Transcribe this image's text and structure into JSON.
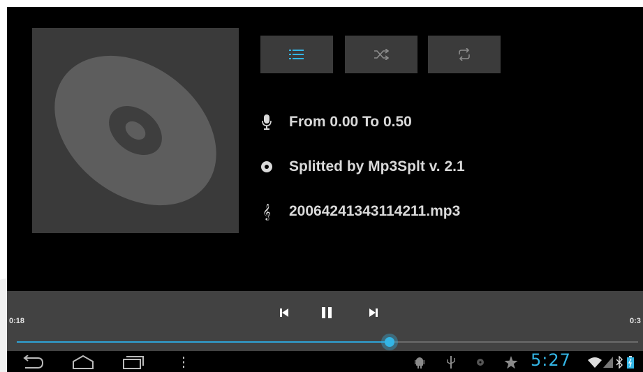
{
  "now_playing": {
    "album_art_icon": "disc-icon",
    "mode_buttons": [
      {
        "name": "playlist-icon",
        "active": true
      },
      {
        "name": "shuffle-icon",
        "active": false
      },
      {
        "name": "repeat-icon",
        "active": false
      }
    ],
    "info": {
      "artist": "From 0.00 To 0.50",
      "album": "Splitted by Mp3Splt v. 2.1",
      "title": "20064241343114211.mp3"
    }
  },
  "playback": {
    "elapsed": "0:18",
    "duration": "0:3",
    "progress": 0.6,
    "state": "playing"
  },
  "system_bar": {
    "clock": "5:27",
    "accent_color": "#33b5e5"
  }
}
